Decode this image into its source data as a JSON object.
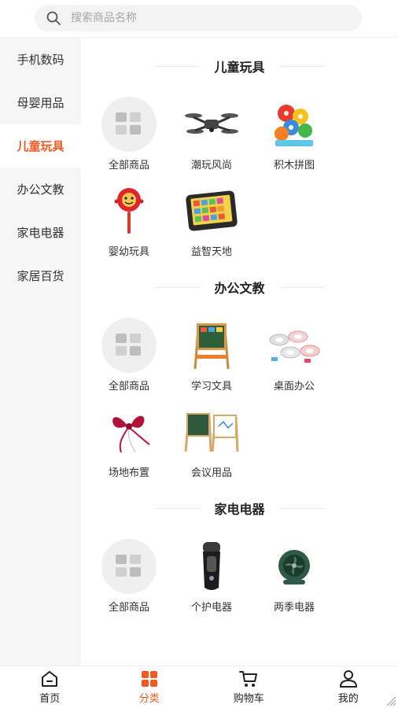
{
  "search": {
    "placeholder": "搜索商品名称"
  },
  "sidebar": {
    "items": [
      {
        "label": "手机数码"
      },
      {
        "label": "母婴用品"
      },
      {
        "label": "儿童玩具",
        "active": true
      },
      {
        "label": "办公文教"
      },
      {
        "label": "家电电器"
      },
      {
        "label": "家居百货"
      }
    ]
  },
  "sections": [
    {
      "title": "儿童玩具",
      "items": [
        {
          "label": "全部商品",
          "icon": "all-products-icon"
        },
        {
          "label": "潮玩风尚",
          "icon": "drone-icon"
        },
        {
          "label": "积木拼图",
          "icon": "building-blocks-icon"
        },
        {
          "label": "婴幼玩具",
          "icon": "rattle-drum-icon"
        },
        {
          "label": "益智天地",
          "icon": "learning-tablet-icon"
        }
      ]
    },
    {
      "title": "办公文教",
      "items": [
        {
          "label": "全部商品",
          "icon": "all-products-icon"
        },
        {
          "label": "学习文具",
          "icon": "easel-board-icon"
        },
        {
          "label": "桌面办公",
          "icon": "tape-rolls-icon"
        },
        {
          "label": "场地布置",
          "icon": "ribbon-bow-icon"
        },
        {
          "label": "会议用品",
          "icon": "whiteboard-easel-icon"
        }
      ]
    },
    {
      "title": "家电电器",
      "items": [
        {
          "label": "全部商品",
          "icon": "all-products-icon"
        },
        {
          "label": "个护电器",
          "icon": "shaver-icon"
        },
        {
          "label": "两季电器",
          "icon": "fan-icon"
        }
      ]
    }
  ],
  "tabbar": {
    "items": [
      {
        "label": "首页",
        "icon": "home-icon"
      },
      {
        "label": "分类",
        "icon": "category-icon",
        "active": true
      },
      {
        "label": "购物车",
        "icon": "cart-icon"
      },
      {
        "label": "我的",
        "icon": "user-icon"
      }
    ]
  },
  "colors": {
    "accent": "#f05a22",
    "sidebar_bg": "#f6f6f6",
    "text": "#222222"
  }
}
